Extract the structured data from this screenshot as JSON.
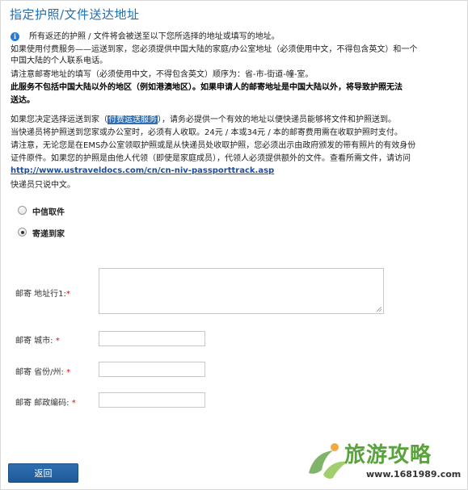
{
  "page": {
    "title": "指定护照/文件送达地址"
  },
  "notice": {
    "line1": "所有返还的护照 / 文件将会被送至以下您所选择的地址或填写的地址。",
    "line2": "如果使用付费服务——运送到家，您必须提供中国大陆的家庭/办公室地址（必须使用中文，不得包含英文）和一个",
    "line3": "中国大陆的个人联系电话。",
    "line4": "请注意邮寄地址的填写（必须使用中文，不得包含英文）顺序为：省-市-街道-幢-室。",
    "bold1": "此服务不包括中国大陆以外的地区（例如港澳地区）。如果申请人的邮寄地址是中国大陆以外，将导致护照无法",
    "bold2": "送达。",
    "p2_before": "如果您决定选择运送到家（",
    "p2_highlight": "付费运送服务",
    "p2_after": "），请务必提供一个有效的地址以便快递员能够将文件和护照送到。",
    "line6": "当快递员将护照送到您家或办公室时，必须有人收取。24元 / 本或34元 / 本的邮寄费用需在收取护照时支付。",
    "line7": "请注意，无论您是在EMS办公室领取护照或是从快递员处收取护照，您必须出示由政府颁发的带有照片的有效身份",
    "line8": "证件原件。如果您的护照是由他人代领（即使是家庭成员），代领人必须提供额外的文件。查看所需文件，请访问",
    "link": "http://www.ustraveldocs.com/cn/cn-niv-passporttrack.asp",
    "line9": "快递员只说中文。"
  },
  "delivery_options": [
    {
      "label": "中信取件",
      "selected": false
    },
    {
      "label": "寄递到家",
      "selected": true
    }
  ],
  "form": {
    "address_label": "邮寄 地址行1:",
    "city_label": "邮寄 城市:",
    "province_label": "邮寄 省份/州:",
    "postcode_label": "邮寄 邮政编码:",
    "required_mark": "*",
    "address_value": "",
    "city_value": "",
    "province_value": "",
    "postcode_value": ""
  },
  "buttons": {
    "back": "返回"
  },
  "watermark": {
    "title": "旅游攻略",
    "url": "www.1681989.com"
  },
  "colors": {
    "title": "#1f6fb3",
    "highlight": "#2f6fb4",
    "button": "#2566a6",
    "required": "#d01010"
  }
}
